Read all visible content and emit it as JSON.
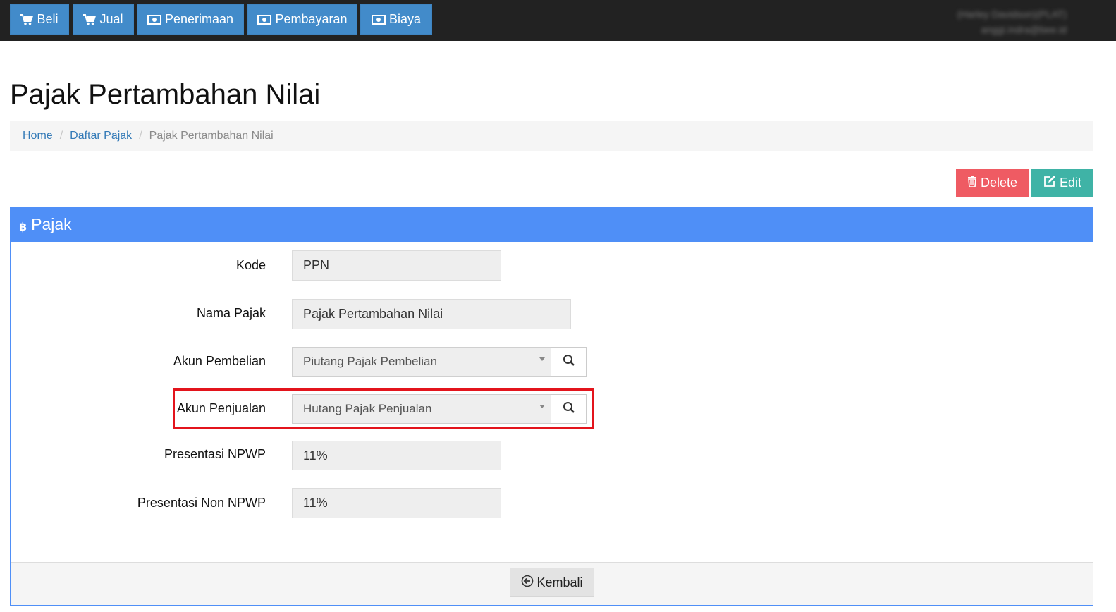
{
  "nav": {
    "items": [
      {
        "label": "Beli",
        "icon": "cart-icon"
      },
      {
        "label": "Jual",
        "icon": "cart-icon"
      },
      {
        "label": "Penerimaan",
        "icon": "money-icon"
      },
      {
        "label": "Pembayaran",
        "icon": "money-icon"
      },
      {
        "label": "Biaya",
        "icon": "money-icon"
      }
    ],
    "user_name": "(Harley Davidson)(PLAT)",
    "user_email": "anggi.indra@bee.id"
  },
  "page": {
    "title": "Pajak Pertambahan Nilai"
  },
  "breadcrumb": {
    "home": "Home",
    "list": "Daftar Pajak",
    "current": "Pajak Pertambahan Nilai"
  },
  "actions": {
    "delete_label": "Delete",
    "edit_label": "Edit"
  },
  "panel": {
    "title": "Pajak",
    "icon": "bitcoin-icon",
    "back_label": "Kembali"
  },
  "form": {
    "kode": {
      "label": "Kode",
      "value": "PPN"
    },
    "nama_pajak": {
      "label": "Nama Pajak",
      "value": "Pajak Pertambahan Nilai"
    },
    "akun_pembelian": {
      "label": "Akun Pembelian",
      "value": "Piutang Pajak Pembelian"
    },
    "akun_penjualan": {
      "label": "Akun Penjualan",
      "value": "Hutang Pajak Penjualan"
    },
    "presentasi_npwp": {
      "label": "Presentasi NPWP",
      "value": "11%"
    },
    "presentasi_non_npwp": {
      "label": "Presentasi Non NPWP",
      "value": "11%"
    }
  },
  "colors": {
    "navbar": "#222222",
    "nav_button": "#428bca",
    "panel_heading": "#4f8ff7",
    "delete": "#ef5b63",
    "edit": "#3fb3a6",
    "highlight": "#e3141c"
  }
}
